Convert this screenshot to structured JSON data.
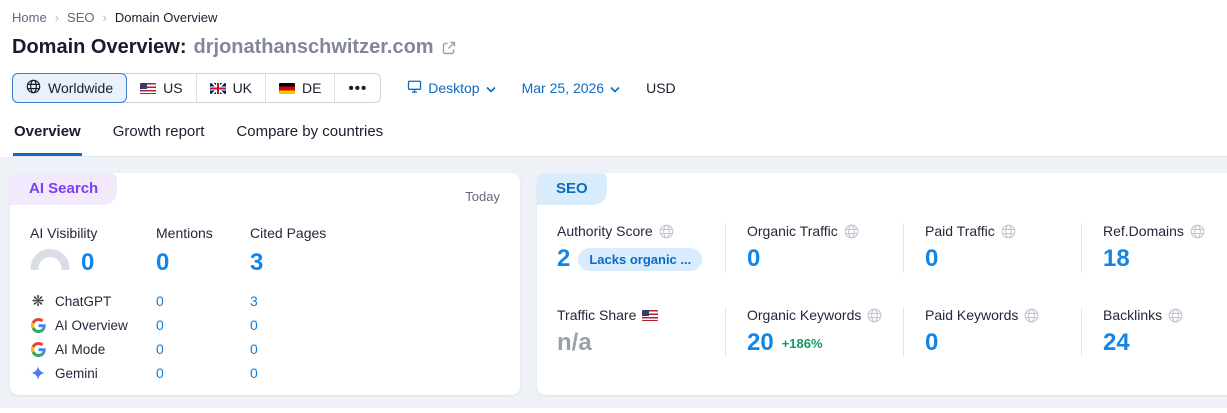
{
  "breadcrumb": {
    "items": [
      "Home",
      "SEO",
      "Domain Overview"
    ]
  },
  "header": {
    "title_prefix": "Domain Overview:",
    "domain": "drjonathanschwitzer.com"
  },
  "toolbar": {
    "regions": [
      {
        "label": "Worldwide",
        "selected": true
      },
      {
        "label": "US"
      },
      {
        "label": "UK"
      },
      {
        "label": "DE"
      }
    ],
    "more_label": "•••",
    "device": "Desktop",
    "date": "Mar 25, 2026",
    "currency": "USD"
  },
  "tabs": [
    {
      "label": "Overview",
      "active": true
    },
    {
      "label": "Growth report"
    },
    {
      "label": "Compare by countries"
    }
  ],
  "ai_card": {
    "badge": "AI Search",
    "period": "Today",
    "columns": [
      "AI Visibility",
      "Mentions",
      "Cited Pages"
    ],
    "totals": {
      "ai_visibility": "0",
      "mentions": "0",
      "cited_pages": "3"
    },
    "rows": [
      {
        "label": "ChatGPT",
        "icon": "chatgpt-icon",
        "mentions": "0",
        "cited_pages": "3"
      },
      {
        "label": "AI Overview",
        "icon": "google-icon",
        "mentions": "0",
        "cited_pages": "0"
      },
      {
        "label": "AI Mode",
        "icon": "google-icon",
        "mentions": "0",
        "cited_pages": "0"
      },
      {
        "label": "Gemini",
        "icon": "gemini-icon",
        "mentions": "0",
        "cited_pages": "0"
      }
    ]
  },
  "seo_card": {
    "badge": "SEO",
    "metrics": [
      {
        "label": "Authority Score",
        "value": "2",
        "tag": "Lacks organic ...",
        "icon": "globe-icon"
      },
      {
        "label": "Organic Traffic",
        "value": "0",
        "icon": "globe-icon"
      },
      {
        "label": "Paid Traffic",
        "value": "0",
        "icon": "globe-icon"
      },
      {
        "label": "Ref.Domains",
        "value": "18",
        "icon": "globe-icon"
      },
      {
        "label": "Traffic Share",
        "value": "n/a",
        "icon": "us-flag-icon"
      },
      {
        "label": "Organic Keywords",
        "value": "20",
        "delta": "+186%",
        "icon": "globe-icon"
      },
      {
        "label": "Paid Keywords",
        "value": "0",
        "icon": "globe-icon"
      },
      {
        "label": "Backlinks",
        "value": "24",
        "icon": "globe-icon"
      }
    ]
  },
  "colors": {
    "metric_blue": "#1285e8",
    "link_blue": "#0e6cc2",
    "delta_green": "#129b60",
    "ai_badge_purple": "#7d3ff0",
    "ai_badge_bg": "#f3e9fd",
    "seo_badge_blue": "#0a6bc4",
    "seo_badge_bg": "#d8ecfc",
    "pill_bg": "#d9ecfd",
    "content_bg": "#eef1f6"
  }
}
